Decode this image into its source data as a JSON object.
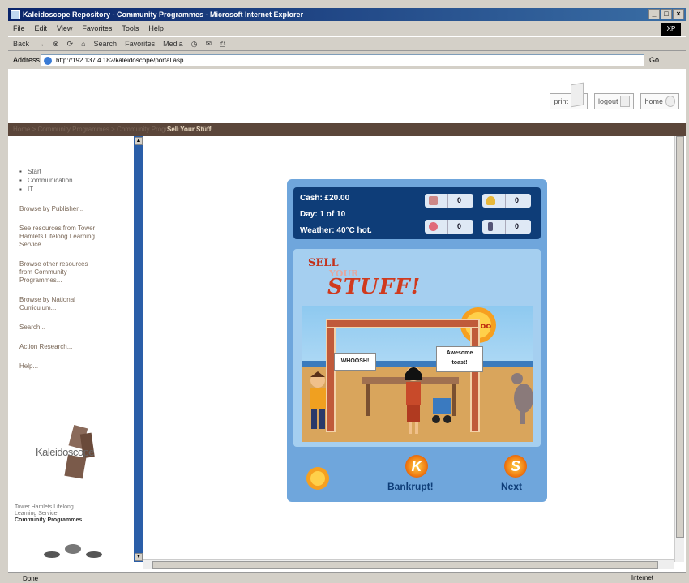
{
  "window": {
    "title": "Kaleidoscope Repository - Community Programmes - Microsoft Internet Explorer",
    "controls": [
      "_",
      "□",
      "×"
    ]
  },
  "menu": [
    "File",
    "Edit",
    "View",
    "Favorites",
    "Tools",
    "Help"
  ],
  "toolbar": {
    "back": "Back",
    "forward": "→",
    "search": "Search",
    "favorites": "Favorites",
    "media": "Media"
  },
  "address": {
    "label": "Address",
    "url": "http://192.137.4.182/kaleidoscope/portal.asp",
    "go": "Go"
  },
  "header": {
    "links": [
      {
        "label": "print",
        "icon": "print-icon"
      },
      {
        "label": "logout",
        "icon": "logout-icon"
      },
      {
        "label": "home",
        "icon": "home-icon"
      }
    ]
  },
  "nav": {
    "crumb_dim": "Home > Community Programmes > Community Programmes > ICT >",
    "crumb": "Sell Your Stuff"
  },
  "sidebar": {
    "bullets": [
      "Start",
      "Communication",
      "IT"
    ],
    "links": [
      "Browse by Publisher...",
      "See resources from Tower Hamlets Lifelong Learning Service...",
      "Browse other resources from Community Programmes...",
      "Browse by National Curriculum...",
      "Search...",
      "Action Research...",
      "Help..."
    ],
    "logo_text": "Kaleidoscope",
    "footer_lines": [
      "Tower Hamlets Lifelong",
      "Learning Service"
    ],
    "footer_bold": "Community Programmes"
  },
  "game": {
    "cash": "Cash: £20.00",
    "day": "Day: 1 of 10",
    "weather": "Weather: 40°C hot.",
    "counters": [
      {
        "icon": "item-icon",
        "value": "0"
      },
      {
        "icon": "bell-icon",
        "value": "0"
      },
      {
        "icon": "soap-icon",
        "value": "0"
      },
      {
        "icon": "bottle-icon",
        "value": "0"
      }
    ],
    "title_line1": "SELL",
    "title_line2": "YOUR",
    "title_line3": "STUFF!",
    "bubble_left": "WHOOSH!",
    "bubble_right": "Awesome toast!",
    "bankrupt_label": "Bankrupt!",
    "next_label": "Next",
    "sun_text": "Tokoo"
  },
  "status": {
    "left": "Done",
    "zone": "Internet"
  },
  "colors": {
    "game_bg": "#6fa6dc",
    "panel": "#0e3d78",
    "nav_strip": "#5b463a",
    "ie_title": "#0a246a"
  }
}
